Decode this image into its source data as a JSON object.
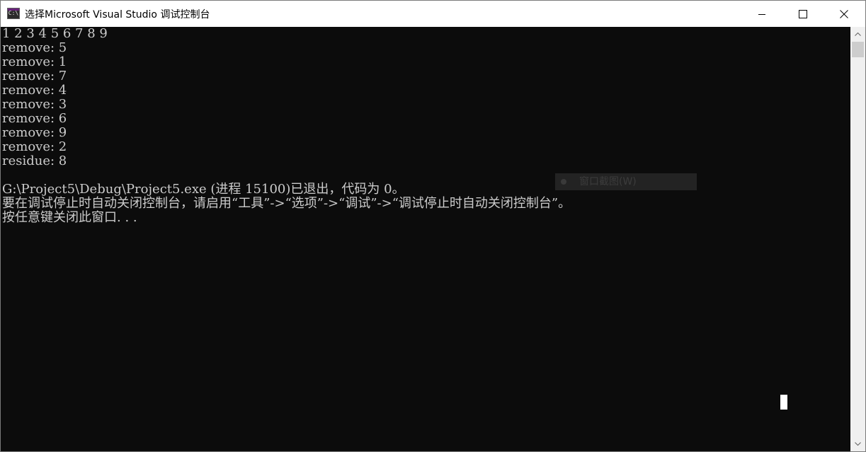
{
  "window": {
    "title": "选择Microsoft Visual Studio 调试控制台",
    "icon": "console-app-icon",
    "icon_glyph": "C:\\",
    "controls": [
      "minimize",
      "maximize",
      "close"
    ]
  },
  "console": {
    "lines": [
      "1 2 3 4 5 6 7 8 9",
      "remove: 5",
      "remove: 1",
      "remove: 7",
      "remove: 4",
      "remove: 3",
      "remove: 6",
      "remove: 9",
      "remove: 2",
      "residue: 8",
      "",
      "G:\\Project5\\Debug\\Project5.exe (进程 15100)已退出，代码为 0。",
      "要在调试停止时自动关闭控制台，请启用“工具”->“选项”->“调试”->“调试停止时自动关闭控制台”。",
      "按任意键关闭此窗口. . ."
    ],
    "background_color": "#0c0c0c",
    "text_color": "#cccccc"
  },
  "overlay": {
    "label": "窗口截图(W)"
  },
  "colors": {
    "titlebar": "#ffffff",
    "scrollbar": "#f0f0f0",
    "icon_accent": "#68217a"
  }
}
